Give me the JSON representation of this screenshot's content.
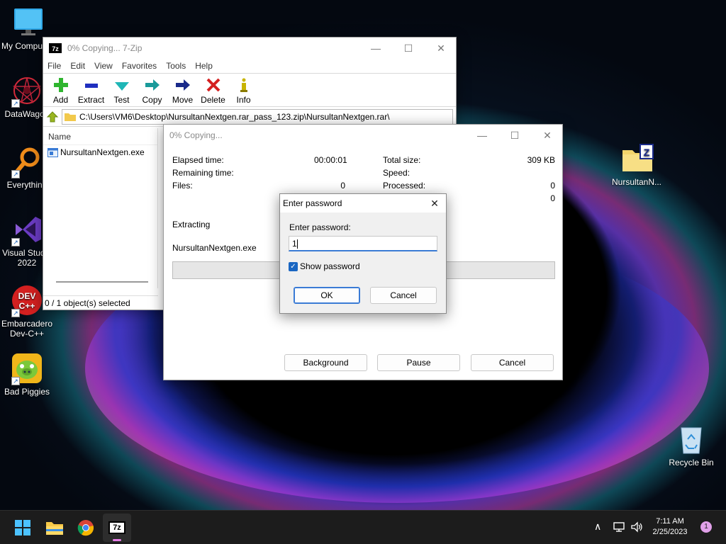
{
  "desktop": {
    "icons": [
      {
        "label": "My Computer",
        "icon": "monitor-icon"
      },
      {
        "label": "DataWagon",
        "icon": "datawagon-icon"
      },
      {
        "label": "Everything",
        "icon": "search-magnifier-icon"
      },
      {
        "label": "Visual Studio 2022",
        "icon": "visual-studio-icon"
      },
      {
        "label": "Embarcadero Dev-C++",
        "icon": "dev-cpp-icon"
      },
      {
        "label": "Bad Piggies",
        "icon": "bad-piggies-icon"
      },
      {
        "label": "NursultanN...",
        "icon": "zip-folder-icon"
      },
      {
        "label": "Recycle Bin",
        "icon": "recycle-bin-icon"
      }
    ]
  },
  "sevenzip": {
    "title": "0% Copying... 7-Zip",
    "menu": [
      "File",
      "Edit",
      "View",
      "Favorites",
      "Tools",
      "Help"
    ],
    "toolbar": [
      {
        "label": "Add",
        "icon": "add-plus-icon",
        "color": "#2fb52f"
      },
      {
        "label": "Extract",
        "icon": "extract-minus-icon",
        "color": "#1f2fbf"
      },
      {
        "label": "Test",
        "icon": "test-check-icon",
        "color": "#1fb6b6"
      },
      {
        "label": "Copy",
        "icon": "copy-arrow-icon",
        "color": "#1a9a9a"
      },
      {
        "label": "Move",
        "icon": "move-arrow-icon",
        "color": "#1a2a8a"
      },
      {
        "label": "Delete",
        "icon": "delete-x-icon",
        "color": "#d42020"
      },
      {
        "label": "Info",
        "icon": "info-icon",
        "color": "#c8b400"
      }
    ],
    "address": "C:\\Users\\VM6\\Desktop\\NursultanNextgen.rar_pass_123.zip\\NursultanNextgen.rar\\",
    "column_name": "Name",
    "file_name": "NursultanNextgen.exe",
    "status": "0 / 1 object(s) selected"
  },
  "copying": {
    "title": "0% Copying...",
    "elapsed_label": "Elapsed time:",
    "elapsed_value": "00:00:01",
    "remaining_label": "Remaining time:",
    "files_label": "Files:",
    "files_value": "0",
    "total_size_label": "Total size:",
    "total_size_value": "309 KB",
    "speed_label": "Speed:",
    "processed_label": "Processed:",
    "processed_value": "0",
    "extra_value": "0",
    "extracting_label": "Extracting",
    "current_file": "NursultanNextgen.exe",
    "progress": 0,
    "background_btn": "Background",
    "pause_btn": "Pause",
    "cancel_btn": "Cancel"
  },
  "password": {
    "title": "Enter password",
    "field_label": "Enter password:",
    "value": "1",
    "show_password_label": "Show password",
    "show_password_checked": true,
    "ok_btn": "OK",
    "cancel_btn": "Cancel"
  },
  "taskbar": {
    "time": "7:11 AM",
    "date": "2/25/2023",
    "notification_count": "1",
    "apps": [
      "start-icon",
      "file-explorer-icon",
      "chrome-icon",
      "7zip-icon"
    ]
  }
}
